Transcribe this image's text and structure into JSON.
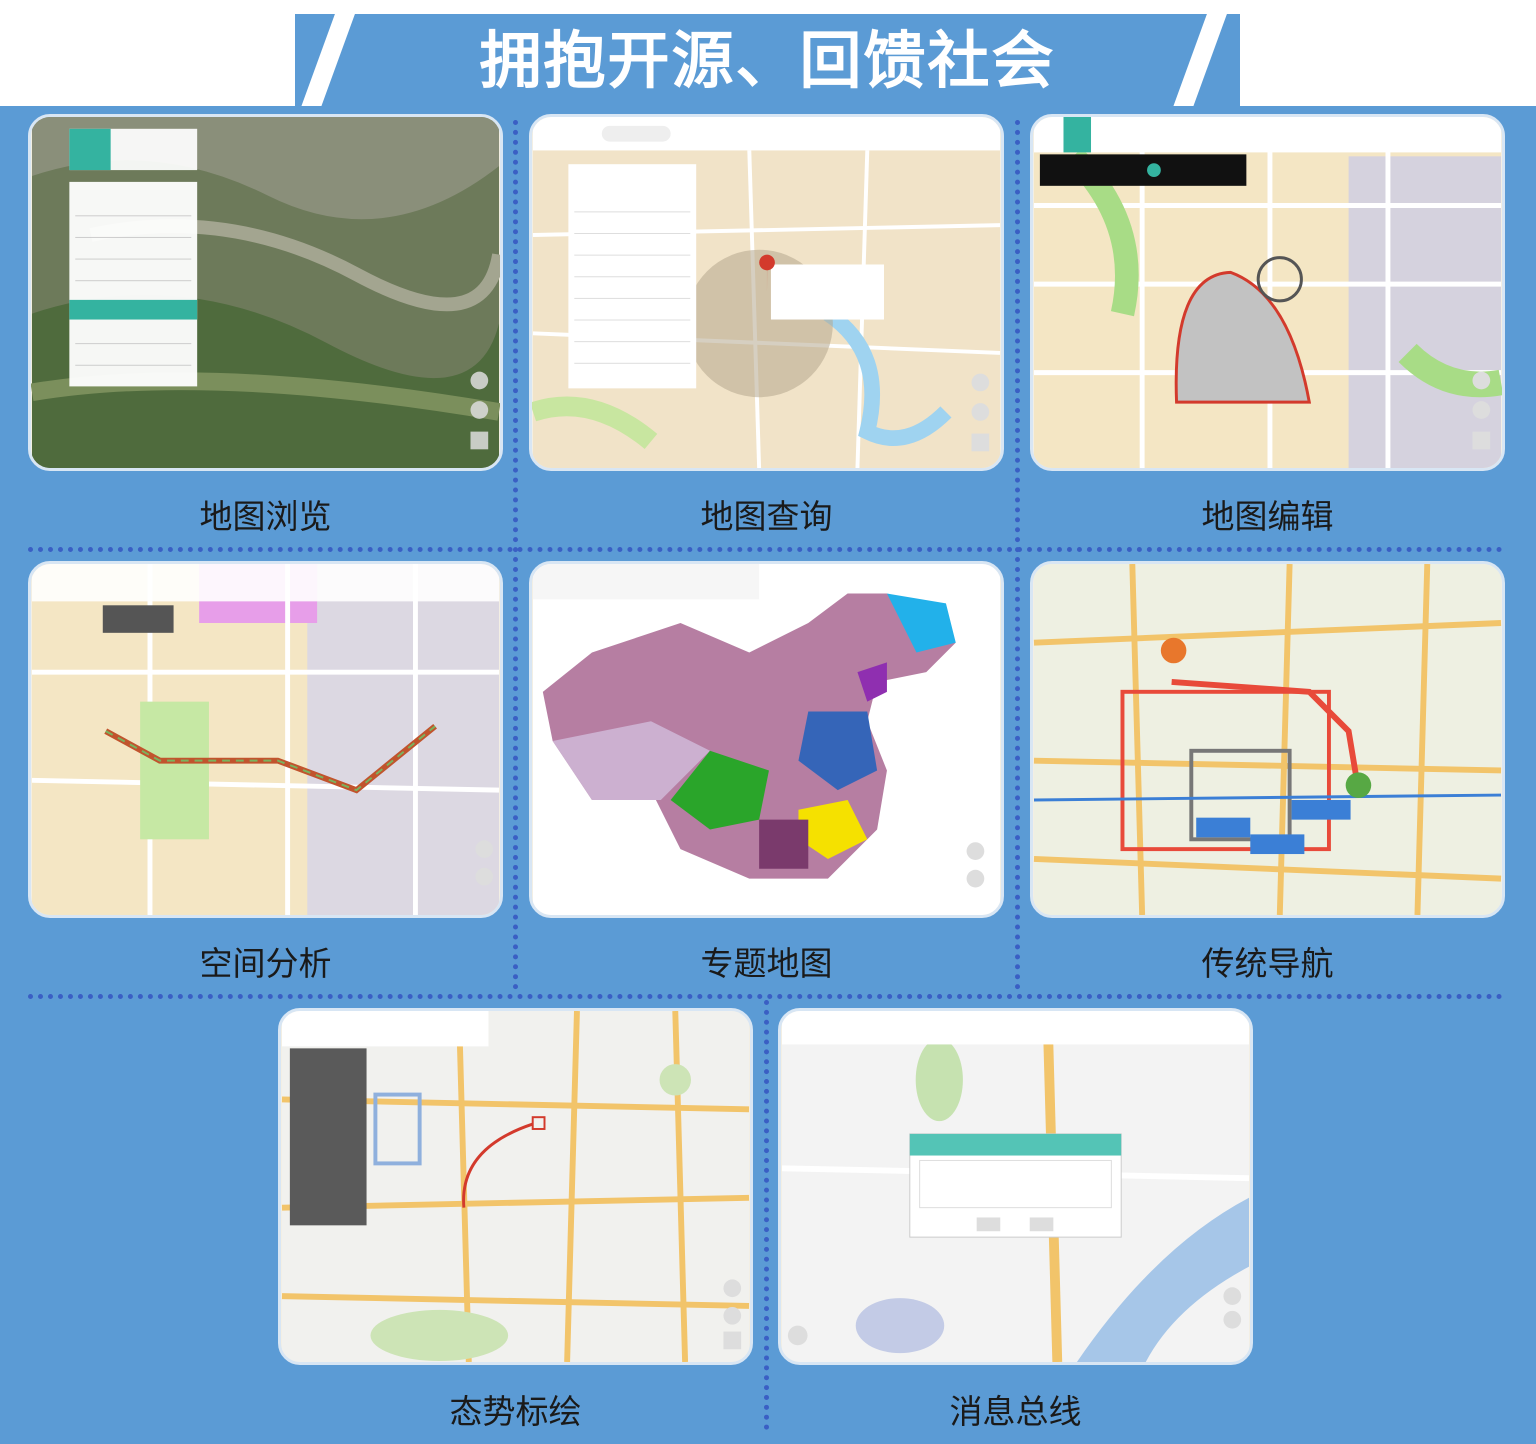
{
  "header": {
    "title": "拥抱开源、回馈社会"
  },
  "features": [
    {
      "caption": "地图浏览"
    },
    {
      "caption": "地图查询"
    },
    {
      "caption": "地图编辑"
    },
    {
      "caption": "空间分析"
    },
    {
      "caption": "专题地图"
    },
    {
      "caption": "传统导航"
    },
    {
      "caption": "态势标绘"
    },
    {
      "caption": "消息总线"
    }
  ],
  "colors": {
    "panel": "#5b9bd5",
    "divider": "#3a5fc4",
    "title_text": "#ffffff",
    "caption_text": "#1a1a1a"
  }
}
